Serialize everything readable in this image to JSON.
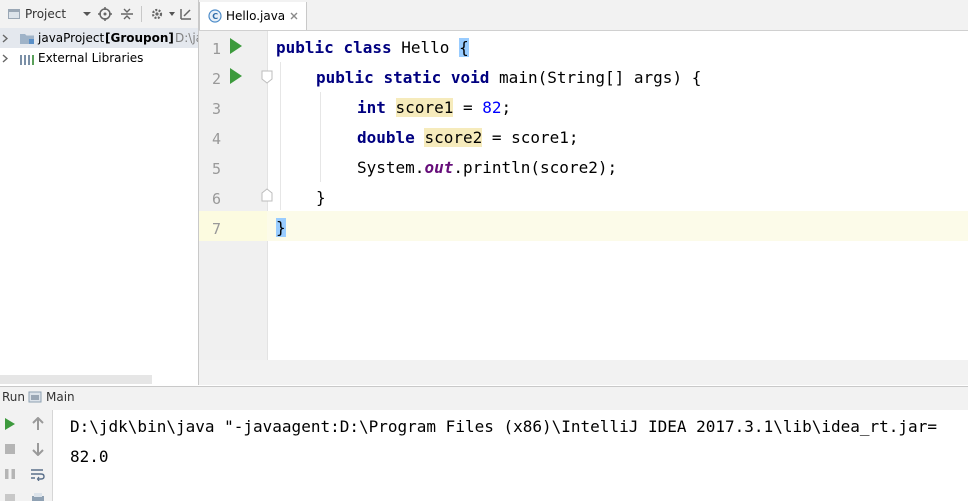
{
  "project_panel": {
    "title": "Project",
    "tree": [
      {
        "label": "javaProject",
        "bold_suffix": "[Groupon]",
        "path": "D:\\ja"
      },
      {
        "label": "External Libraries"
      }
    ]
  },
  "editor": {
    "tab_label": "Hello.java",
    "line_numbers": [
      "1",
      "2",
      "3",
      "4",
      "5",
      "6",
      "7"
    ],
    "code": {
      "l1": {
        "kw1": "public",
        "kw2": "class",
        "name": "Hello",
        "brace": "{"
      },
      "l2": {
        "kw1": "public",
        "kw2": "static",
        "kw3": "void",
        "rest": "main(String[] args) {"
      },
      "l3": {
        "kw": "int",
        "var": "score1",
        "op": " = ",
        "num": "82",
        "end": ";"
      },
      "l4": {
        "kw": "double",
        "var": "score2",
        "rest": " = score1;"
      },
      "l5": {
        "obj": "System.",
        "field": "out",
        "rest": ".println(score2);"
      },
      "l6": {
        "brace": "}"
      },
      "l7": {
        "brace": "}"
      }
    }
  },
  "run_panel": {
    "tab_prefix": "Run",
    "config_name": "Main",
    "console": [
      "D:\\jdk\\bin\\java \"-javaagent:D:\\Program Files (x86)\\IntelliJ IDEA 2017.3.1\\lib\\idea_rt.jar=",
      "82.0"
    ]
  },
  "colors": {
    "keyword": "#000080",
    "number": "#0000ff",
    "static_field": "#660e7a",
    "run_green": "#3d9a3d"
  }
}
